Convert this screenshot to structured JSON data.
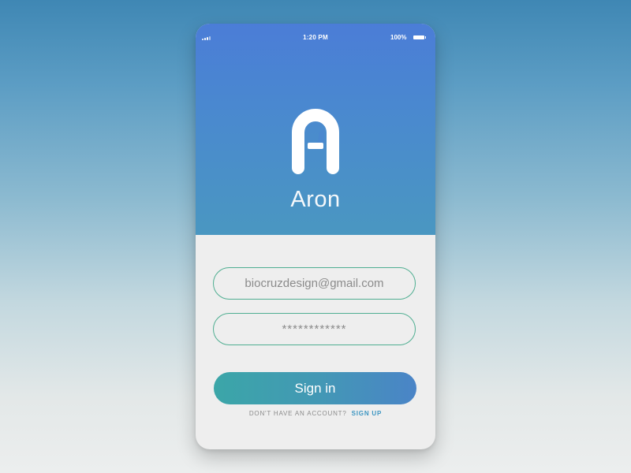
{
  "app": {
    "name": "Aron",
    "status_bar": {
      "time": "1:20 PM",
      "battery_percent": "100%"
    },
    "logo_icon": "aron-logo-icon",
    "signal_icon": "signal-icon",
    "battery_icon": "battery-icon"
  },
  "login_form": {
    "email_value": "biocruzdesign@gmail.com",
    "password_value": "************",
    "signin_label": "Sign in",
    "signup_prompt": "DON'T HAVE AN ACCOUNT?",
    "signup_link": "SIGN UP"
  },
  "colors": {
    "header_top": "#4b7dd7",
    "header_bottom": "#4a97c1",
    "form_background": "#eeeeee",
    "input_border": "#4fae91",
    "button_start": "#3ba6a8",
    "button_end": "#4a84c7",
    "link": "#3d96c2",
    "muted_text": "#8b8b8b"
  }
}
